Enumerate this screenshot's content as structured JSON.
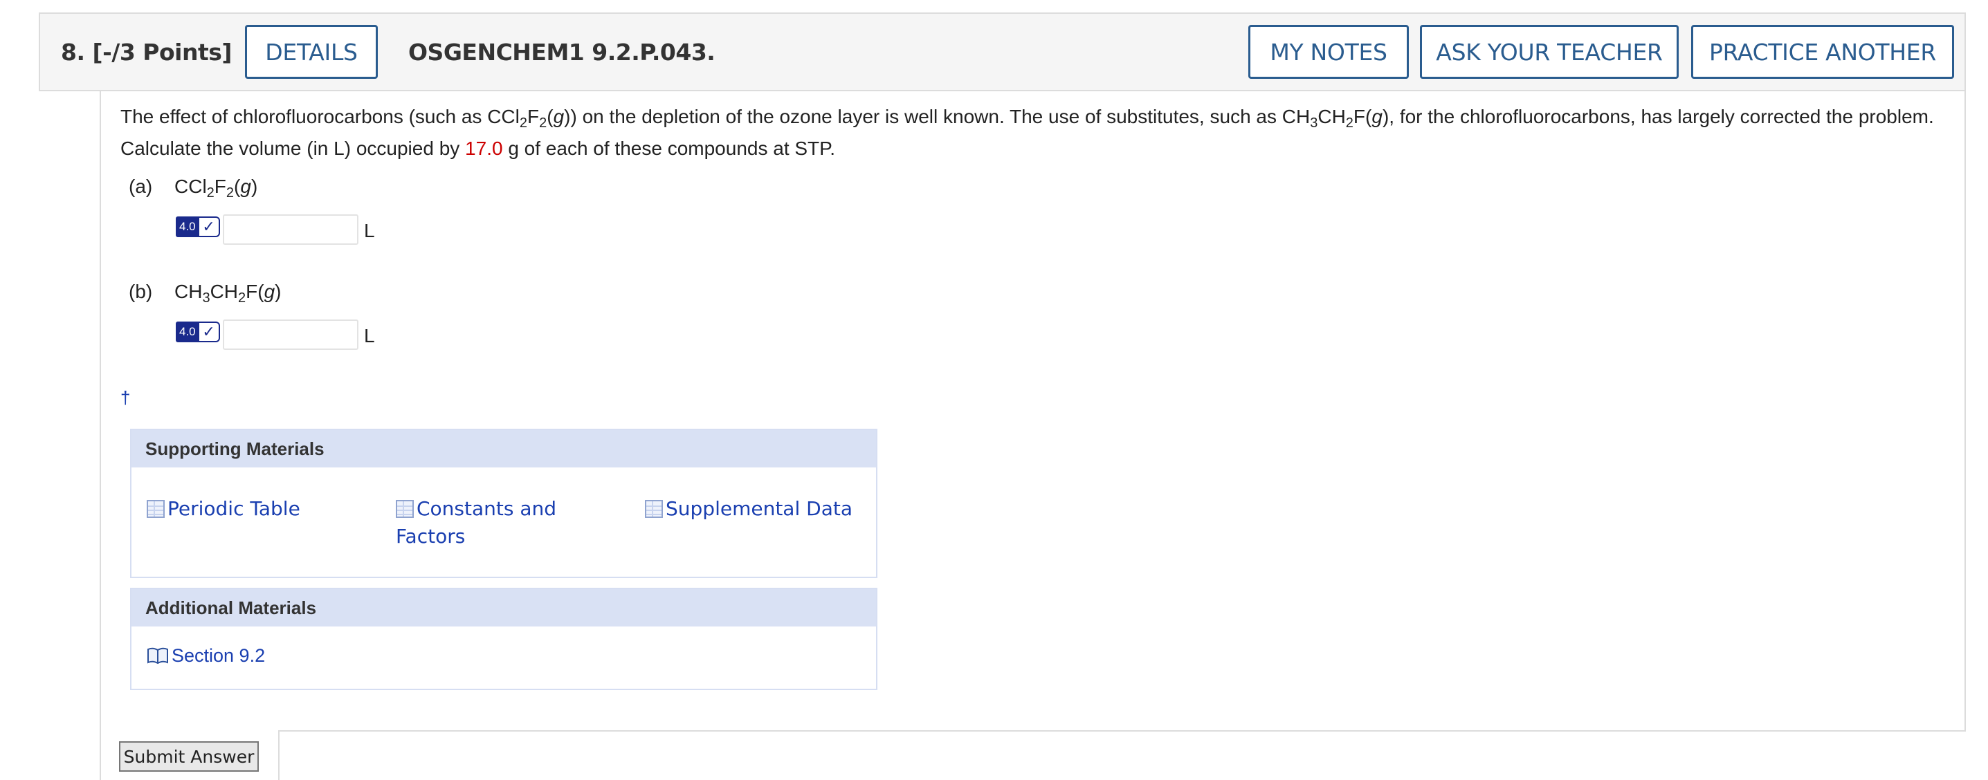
{
  "header": {
    "question_number": "8.",
    "points": "[-/3 Points]",
    "details_label": "DETAILS",
    "question_code": "OSGENCHEM1 9.2.P.043.",
    "my_notes_label": "MY NOTES",
    "ask_teacher_label": "ASK YOUR TEACHER",
    "practice_another_label": "PRACTICE ANOTHER"
  },
  "question": {
    "text_1": "The effect of chlorofluorocarbons (such as CCl",
    "sub_1": "2",
    "text_2": "F",
    "sub_2": "2",
    "text_3": "(",
    "g_1": "g",
    "text_4": ")) on the depletion of the ozone layer is well known. The use of substitutes, such as CH",
    "sub_3": "3",
    "text_5": "CH",
    "sub_4": "2",
    "text_6": "F(",
    "g_2": "g",
    "text_7": "), for the chlorofluorocarbons, has largely corrected the problem. Calculate the volume (in L) occupied by ",
    "mass_value": "17.0",
    "text_8": " g of each of these compounds at STP."
  },
  "parts": [
    {
      "letter": "(a)",
      "formula_1": "CCl",
      "sub_1": "2",
      "formula_2": "F",
      "sub_2": "2",
      "formula_3": "(",
      "phase": "g",
      "formula_4": ")",
      "badge": "4.0",
      "check_icon": "check-icon",
      "answer_value": "",
      "unit": "L"
    },
    {
      "letter": "(b)",
      "formula_1": "CH",
      "sub_1": "3",
      "formula_2": "CH",
      "sub_2": "2",
      "formula_3": "F(",
      "phase": "g",
      "formula_4": ")",
      "badge": "4.0",
      "check_icon": "check-icon",
      "answer_value": "",
      "unit": "L"
    }
  ],
  "dagger": "†",
  "supporting_materials": {
    "title": "Supporting Materials",
    "links": [
      {
        "label": "Periodic Table",
        "icon": "table-icon"
      },
      {
        "label": "Constants and Factors",
        "icon": "table-icon"
      },
      {
        "label": "Supplemental Data",
        "icon": "table-icon"
      }
    ]
  },
  "additional_materials": {
    "title": "Additional Materials",
    "links": [
      {
        "label": "Section 9.2",
        "icon": "book-icon"
      }
    ]
  },
  "submit_label": "Submit Answer",
  "colors": {
    "button_border": "#2a5c8f",
    "link": "#1a3fb0",
    "highlight_value": "#cc0000",
    "panel_header": "#d9e1f4",
    "badge": "#1a2a8c"
  }
}
